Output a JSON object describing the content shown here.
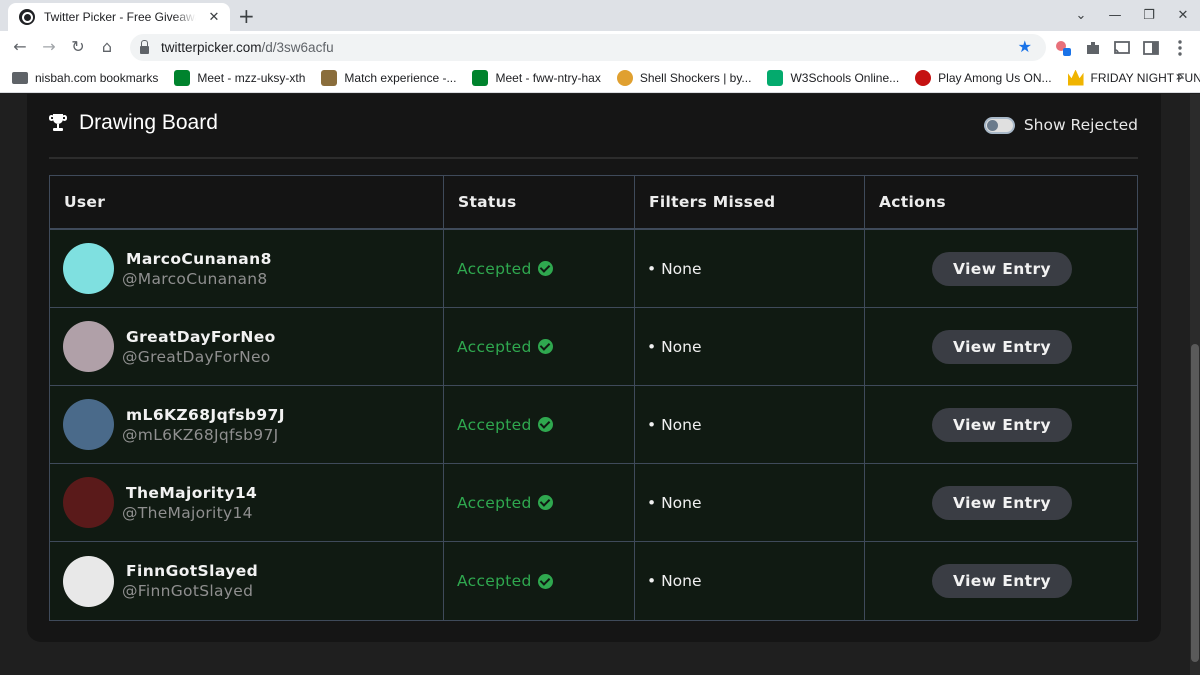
{
  "browser": {
    "tab_title": "Twitter Picker - Free Giveaway Pi",
    "tab_close": "✕",
    "new_tab": "+",
    "url_host": "twitterpicker.com",
    "url_path": "/d/3sw6acfu",
    "bookmarks": [
      {
        "label": "nisbah.com bookmarks",
        "icon": "folder-icon",
        "color": "#5f6368"
      },
      {
        "label": "Meet - mzz-uksy-xth",
        "icon": "google-meet-icon",
        "color": "#00832d"
      },
      {
        "label": "Match experience -...",
        "icon": "match-experience-icon",
        "color": "#8a6d3b"
      },
      {
        "label": "Meet - fww-ntry-hax",
        "icon": "google-meet-icon",
        "color": "#00832d"
      },
      {
        "label": "Shell Shockers | by...",
        "icon": "shell-shockers-icon",
        "color": "#e0a030"
      },
      {
        "label": "W3Schools Online...",
        "icon": "w3schools-icon",
        "color": "#04aa6d"
      },
      {
        "label": "Play Among Us ON...",
        "icon": "among-us-icon",
        "color": "#c51111"
      },
      {
        "label": "FRIDAY NIGHT FUN...",
        "icon": "crown-icon",
        "color": "#f0b400"
      }
    ],
    "bookmarks_more": "»"
  },
  "board": {
    "title": "Drawing Board",
    "show_rejected_label": "Show Rejected",
    "show_rejected_on": false
  },
  "table": {
    "headers": [
      "User",
      "Status",
      "Filters Missed",
      "Actions"
    ],
    "rows": [
      {
        "name": "MarcoCunanan8",
        "handle": "@MarcoCunanan8",
        "status": "Accepted",
        "filters": "None",
        "action": "View Entry",
        "avatar_color": "#7fe0e0"
      },
      {
        "name": "GreatDayForNeo",
        "handle": "@GreatDayForNeo",
        "status": "Accepted",
        "filters": "None",
        "action": "View Entry",
        "avatar_color": "#b0a0a8"
      },
      {
        "name": "mL6KZ68Jqfsb97J",
        "handle": "@mL6KZ68Jqfsb97J",
        "status": "Accepted",
        "filters": "None",
        "action": "View Entry",
        "avatar_color": "#4a6a8a"
      },
      {
        "name": "TheMajority14",
        "handle": "@TheMajority14",
        "status": "Accepted",
        "filters": "None",
        "action": "View Entry",
        "avatar_color": "#5a1a1a"
      },
      {
        "name": "FinnGotSlayed",
        "handle": "@FinnGotSlayed",
        "status": "Accepted",
        "filters": "None",
        "action": "View Entry",
        "avatar_color": "#e8e8e8"
      }
    ]
  },
  "colors": {
    "accent_green": "#2fa84f",
    "card_bg": "#151515",
    "row_bg": "#101a12",
    "border": "#3f4a5a"
  }
}
